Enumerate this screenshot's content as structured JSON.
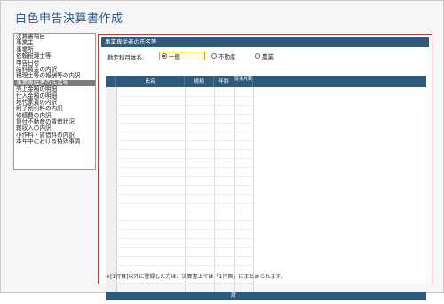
{
  "app": {
    "title": "白色申告決算書作成"
  },
  "nav": {
    "items": [
      "決算書項目",
      "事業主",
      "事業所",
      "依頼税理士等",
      "申告日付",
      "給料賃金の内訳",
      "税理士等の報酬等の内訳",
      "事業専従者の氏名等",
      "売上金額の明細",
      "仕入金額の明細",
      "地代家賃の内訳",
      "利子割引料の内訳",
      "修繕費の内訳",
      "貸付不動産の賃借状況",
      "雑収入の内訳",
      "小作料・賃借料の内訳",
      "本年中における特殊事情"
    ],
    "active_index": 7
  },
  "panel": {
    "header": "事業専従者の氏名等",
    "category_label": "勘定科目体系:",
    "options": [
      {
        "label": "一般",
        "selected": true
      },
      {
        "label": "不動産",
        "selected": false
      },
      {
        "label": "農業",
        "selected": false
      }
    ],
    "columns": [
      "氏名",
      "続柄",
      "年齢",
      "従事月数"
    ],
    "footer_label": "計",
    "note": "※[1行目]以外に登録した方は、決算書上では「1行目」にまとめられます。"
  },
  "colors": {
    "accent": "#2f5a7c",
    "title": "#2d5a8a",
    "panel_border": "#b0413e",
    "selected_outline": "#e0a400"
  }
}
